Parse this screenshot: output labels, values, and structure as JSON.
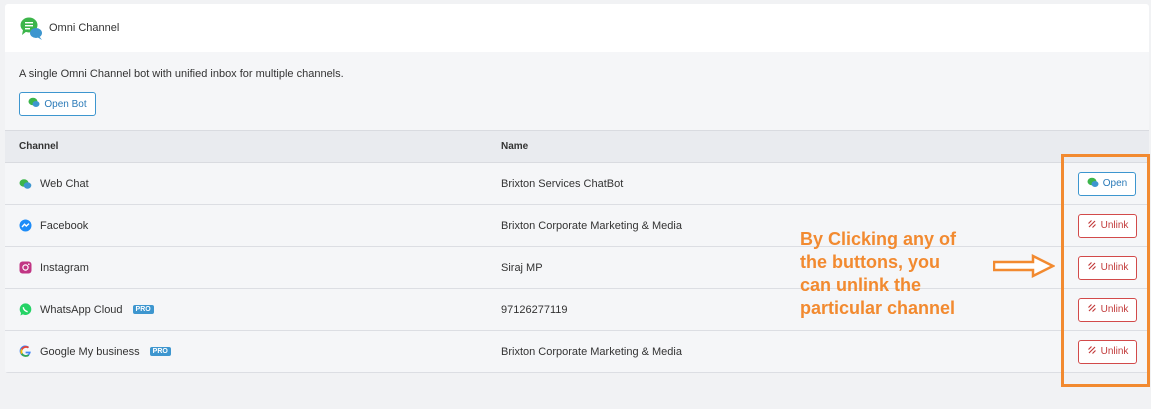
{
  "header": {
    "title": "Omni Channel",
    "icon": "chat-bubbles-icon"
  },
  "description": "A single Omni Channel bot with unified inbox for multiple channels.",
  "open_bot_button": {
    "label": "Open Bot",
    "icon": "chat-bubbles-icon"
  },
  "table": {
    "columns": [
      "Channel",
      "Name"
    ],
    "rows": [
      {
        "channel": "Web Chat",
        "icon": "webchat-icon",
        "pro": false,
        "name": "Brixton Services ChatBot",
        "action": "Open"
      },
      {
        "channel": "Facebook",
        "icon": "messenger-icon",
        "pro": false,
        "name": "Brixton Corporate Marketing & Media",
        "action": "Unlink"
      },
      {
        "channel": "Instagram",
        "icon": "instagram-icon",
        "pro": false,
        "name": "Siraj MP",
        "action": "Unlink"
      },
      {
        "channel": "WhatsApp Cloud",
        "icon": "whatsapp-icon",
        "pro": true,
        "name": "97126277119",
        "action": "Unlink"
      },
      {
        "channel": "Google My business",
        "icon": "google-icon",
        "pro": true,
        "name": "Brixton Corporate Marketing & Media",
        "action": "Unlink"
      }
    ],
    "pro_badge": "PRO"
  },
  "annotation": {
    "lines": [
      "By Clicking any of",
      "the buttons, you",
      "can unlink the",
      "particular channel"
    ]
  },
  "colors": {
    "accent_blue": "#3d96cf",
    "unlink_red": "#c23b3b",
    "annotation_orange": "#f28a30"
  }
}
